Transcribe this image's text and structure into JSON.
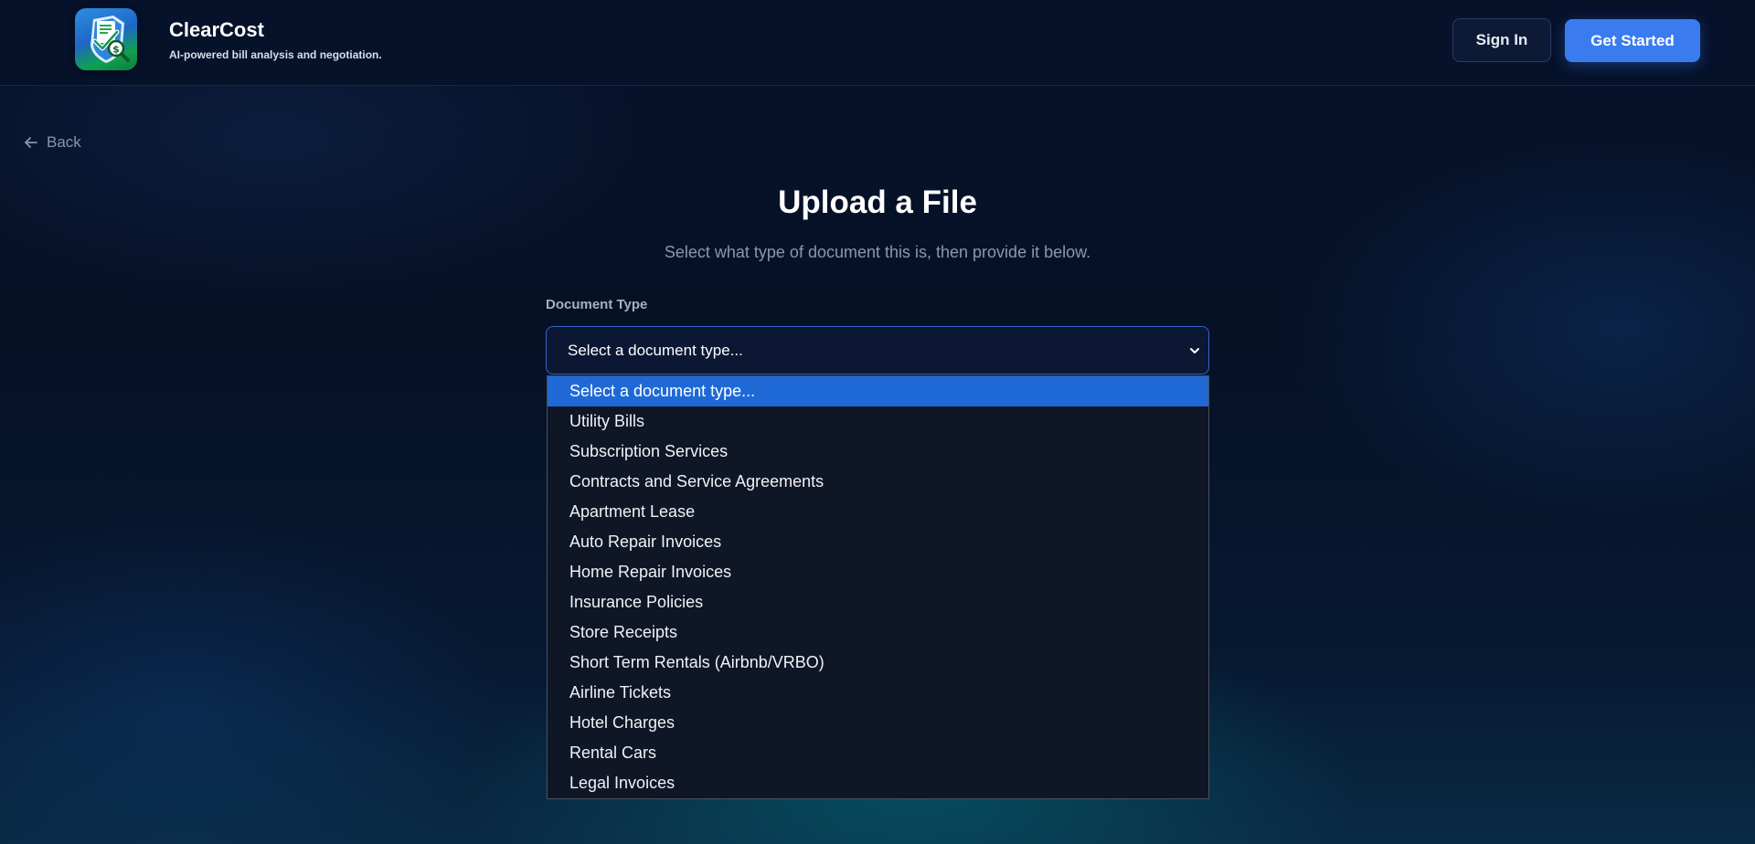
{
  "header": {
    "brand_name": "ClearCost",
    "tagline": "AI-powered bill analysis and negotiation.",
    "sign_in_label": "Sign In",
    "get_started_label": "Get Started"
  },
  "nav": {
    "back_label": "Back"
  },
  "main": {
    "title": "Upload a File",
    "subtitle": "Select what type of document this is, then provide it below.",
    "doc_type_label": "Document Type",
    "select_value": "Select a document type..."
  },
  "dropdown": {
    "options": [
      "Select a document type...",
      "Utility Bills",
      "Subscription Services",
      "Contracts and Service Agreements",
      "Apartment Lease",
      "Auto Repair Invoices",
      "Home Repair Invoices",
      "Insurance Policies",
      "Store Receipts",
      "Short Term Rentals (Airbnb/VRBO)",
      "Airline Tickets",
      "Hotel Charges",
      "Rental Cars",
      "Legal Invoices"
    ],
    "selected_index": 0
  },
  "icons": {
    "logo": "document-shield-dollar-magnifier-icon",
    "back": "arrow-left-icon",
    "select": "chevron-down-icon"
  },
  "colors": {
    "accent": "#3a7bf0",
    "option_highlight": "#1f69d6",
    "page_bg": "#06122a"
  }
}
